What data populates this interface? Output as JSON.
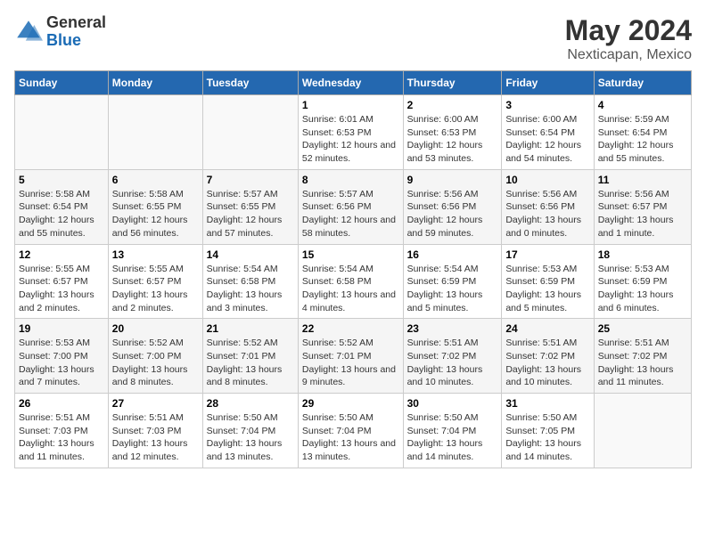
{
  "logo": {
    "general": "General",
    "blue": "Blue"
  },
  "title": "May 2024",
  "subtitle": "Nexticapan, Mexico",
  "headers": [
    "Sunday",
    "Monday",
    "Tuesday",
    "Wednesday",
    "Thursday",
    "Friday",
    "Saturday"
  ],
  "weeks": [
    [
      {
        "day": "",
        "sunrise": "",
        "sunset": "",
        "daylight": ""
      },
      {
        "day": "",
        "sunrise": "",
        "sunset": "",
        "daylight": ""
      },
      {
        "day": "",
        "sunrise": "",
        "sunset": "",
        "daylight": ""
      },
      {
        "day": "1",
        "sunrise": "6:01 AM",
        "sunset": "6:53 PM",
        "daylight": "12 hours and 52 minutes."
      },
      {
        "day": "2",
        "sunrise": "6:00 AM",
        "sunset": "6:53 PM",
        "daylight": "12 hours and 53 minutes."
      },
      {
        "day": "3",
        "sunrise": "6:00 AM",
        "sunset": "6:54 PM",
        "daylight": "12 hours and 54 minutes."
      },
      {
        "day": "4",
        "sunrise": "5:59 AM",
        "sunset": "6:54 PM",
        "daylight": "12 hours and 55 minutes."
      }
    ],
    [
      {
        "day": "5",
        "sunrise": "5:58 AM",
        "sunset": "6:54 PM",
        "daylight": "12 hours and 55 minutes."
      },
      {
        "day": "6",
        "sunrise": "5:58 AM",
        "sunset": "6:55 PM",
        "daylight": "12 hours and 56 minutes."
      },
      {
        "day": "7",
        "sunrise": "5:57 AM",
        "sunset": "6:55 PM",
        "daylight": "12 hours and 57 minutes."
      },
      {
        "day": "8",
        "sunrise": "5:57 AM",
        "sunset": "6:56 PM",
        "daylight": "12 hours and 58 minutes."
      },
      {
        "day": "9",
        "sunrise": "5:56 AM",
        "sunset": "6:56 PM",
        "daylight": "12 hours and 59 minutes."
      },
      {
        "day": "10",
        "sunrise": "5:56 AM",
        "sunset": "6:56 PM",
        "daylight": "13 hours and 0 minutes."
      },
      {
        "day": "11",
        "sunrise": "5:56 AM",
        "sunset": "6:57 PM",
        "daylight": "13 hours and 1 minute."
      }
    ],
    [
      {
        "day": "12",
        "sunrise": "5:55 AM",
        "sunset": "6:57 PM",
        "daylight": "13 hours and 2 minutes."
      },
      {
        "day": "13",
        "sunrise": "5:55 AM",
        "sunset": "6:57 PM",
        "daylight": "13 hours and 2 minutes."
      },
      {
        "day": "14",
        "sunrise": "5:54 AM",
        "sunset": "6:58 PM",
        "daylight": "13 hours and 3 minutes."
      },
      {
        "day": "15",
        "sunrise": "5:54 AM",
        "sunset": "6:58 PM",
        "daylight": "13 hours and 4 minutes."
      },
      {
        "day": "16",
        "sunrise": "5:54 AM",
        "sunset": "6:59 PM",
        "daylight": "13 hours and 5 minutes."
      },
      {
        "day": "17",
        "sunrise": "5:53 AM",
        "sunset": "6:59 PM",
        "daylight": "13 hours and 5 minutes."
      },
      {
        "day": "18",
        "sunrise": "5:53 AM",
        "sunset": "6:59 PM",
        "daylight": "13 hours and 6 minutes."
      }
    ],
    [
      {
        "day": "19",
        "sunrise": "5:53 AM",
        "sunset": "7:00 PM",
        "daylight": "13 hours and 7 minutes."
      },
      {
        "day": "20",
        "sunrise": "5:52 AM",
        "sunset": "7:00 PM",
        "daylight": "13 hours and 8 minutes."
      },
      {
        "day": "21",
        "sunrise": "5:52 AM",
        "sunset": "7:01 PM",
        "daylight": "13 hours and 8 minutes."
      },
      {
        "day": "22",
        "sunrise": "5:52 AM",
        "sunset": "7:01 PM",
        "daylight": "13 hours and 9 minutes."
      },
      {
        "day": "23",
        "sunrise": "5:51 AM",
        "sunset": "7:02 PM",
        "daylight": "13 hours and 10 minutes."
      },
      {
        "day": "24",
        "sunrise": "5:51 AM",
        "sunset": "7:02 PM",
        "daylight": "13 hours and 10 minutes."
      },
      {
        "day": "25",
        "sunrise": "5:51 AM",
        "sunset": "7:02 PM",
        "daylight": "13 hours and 11 minutes."
      }
    ],
    [
      {
        "day": "26",
        "sunrise": "5:51 AM",
        "sunset": "7:03 PM",
        "daylight": "13 hours and 11 minutes."
      },
      {
        "day": "27",
        "sunrise": "5:51 AM",
        "sunset": "7:03 PM",
        "daylight": "13 hours and 12 minutes."
      },
      {
        "day": "28",
        "sunrise": "5:50 AM",
        "sunset": "7:04 PM",
        "daylight": "13 hours and 13 minutes."
      },
      {
        "day": "29",
        "sunrise": "5:50 AM",
        "sunset": "7:04 PM",
        "daylight": "13 hours and 13 minutes."
      },
      {
        "day": "30",
        "sunrise": "5:50 AM",
        "sunset": "7:04 PM",
        "daylight": "13 hours and 14 minutes."
      },
      {
        "day": "31",
        "sunrise": "5:50 AM",
        "sunset": "7:05 PM",
        "daylight": "13 hours and 14 minutes."
      },
      {
        "day": "",
        "sunrise": "",
        "sunset": "",
        "daylight": ""
      }
    ]
  ]
}
